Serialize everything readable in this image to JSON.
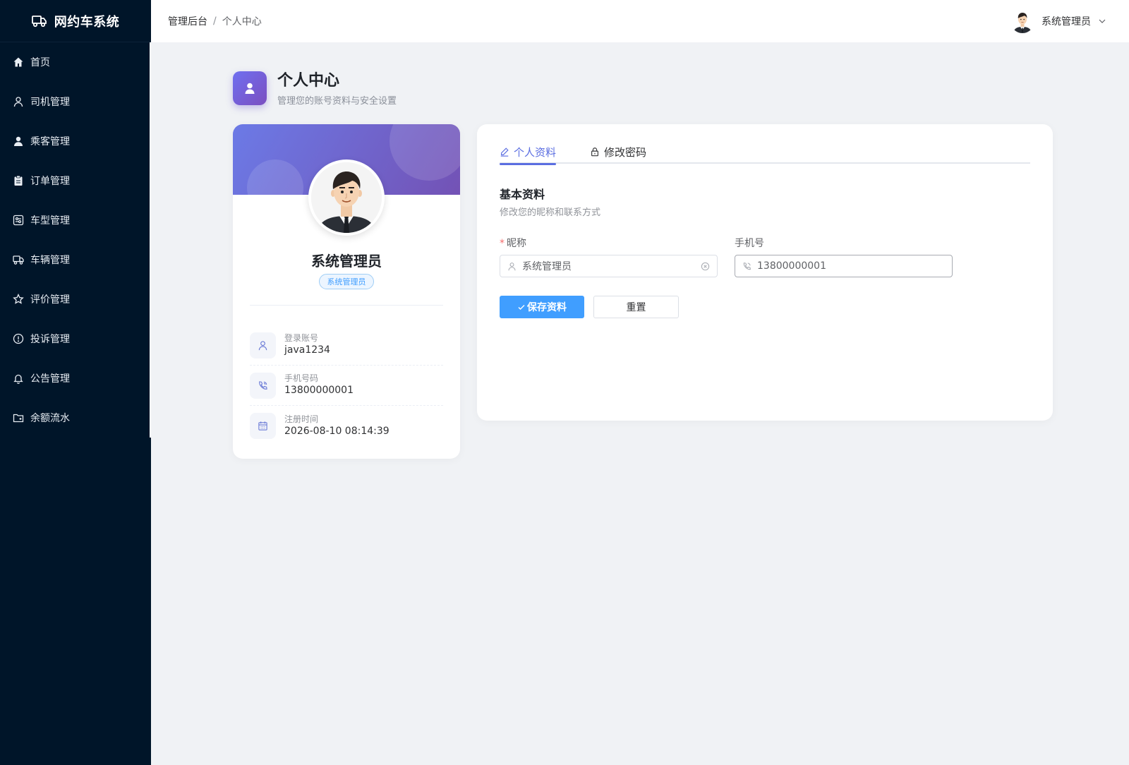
{
  "app": {
    "title": "网约车系统"
  },
  "sidebar": {
    "items": [
      {
        "label": "首页",
        "icon": "home-icon"
      },
      {
        "label": "司机管理",
        "icon": "user-outline-icon"
      },
      {
        "label": "乘客管理",
        "icon": "user-filled-icon"
      },
      {
        "label": "订单管理",
        "icon": "clipboard-icon"
      },
      {
        "label": "车型管理",
        "icon": "settings-panel-icon"
      },
      {
        "label": "车辆管理",
        "icon": "truck-icon"
      },
      {
        "label": "评价管理",
        "icon": "star-icon"
      },
      {
        "label": "投诉管理",
        "icon": "warning-icon"
      },
      {
        "label": "公告管理",
        "icon": "bell-icon"
      },
      {
        "label": "余额流水",
        "icon": "folder-icon"
      }
    ]
  },
  "header": {
    "breadcrumb": [
      "管理后台",
      "个人中心"
    ],
    "separator": "/",
    "username": "系统管理员"
  },
  "page": {
    "title": "个人中心",
    "subtitle": "管理您的账号资料与安全设置"
  },
  "profile": {
    "name": "系统管理员",
    "role": "系统管理员",
    "info": [
      {
        "label": "登录账号",
        "value": "java1234",
        "icon": "user-icon"
      },
      {
        "label": "手机号码",
        "value": "13800000001",
        "icon": "phone-icon"
      },
      {
        "label": "注册时间",
        "value": "2026-08-10 08:14:39",
        "icon": "calendar-icon"
      }
    ]
  },
  "tabs": [
    {
      "label": "个人资料",
      "icon": "edit-icon",
      "active": true
    },
    {
      "label": "修改密码",
      "icon": "lock-icon",
      "active": false
    }
  ],
  "form": {
    "section_title": "基本资料",
    "section_desc": "修改您的昵称和联系方式",
    "nickname_label": "昵称",
    "nickname_required": "*",
    "nickname_value": "系统管理员",
    "phone_label": "手机号",
    "phone_value": "13800000001",
    "save_label": "保存资料",
    "reset_label": "重置"
  },
  "colors": {
    "sidebar_bg": "#001529",
    "accent": "#5b6ee1",
    "primary_button": "#409eff",
    "page_bg": "#f0f2f5"
  }
}
